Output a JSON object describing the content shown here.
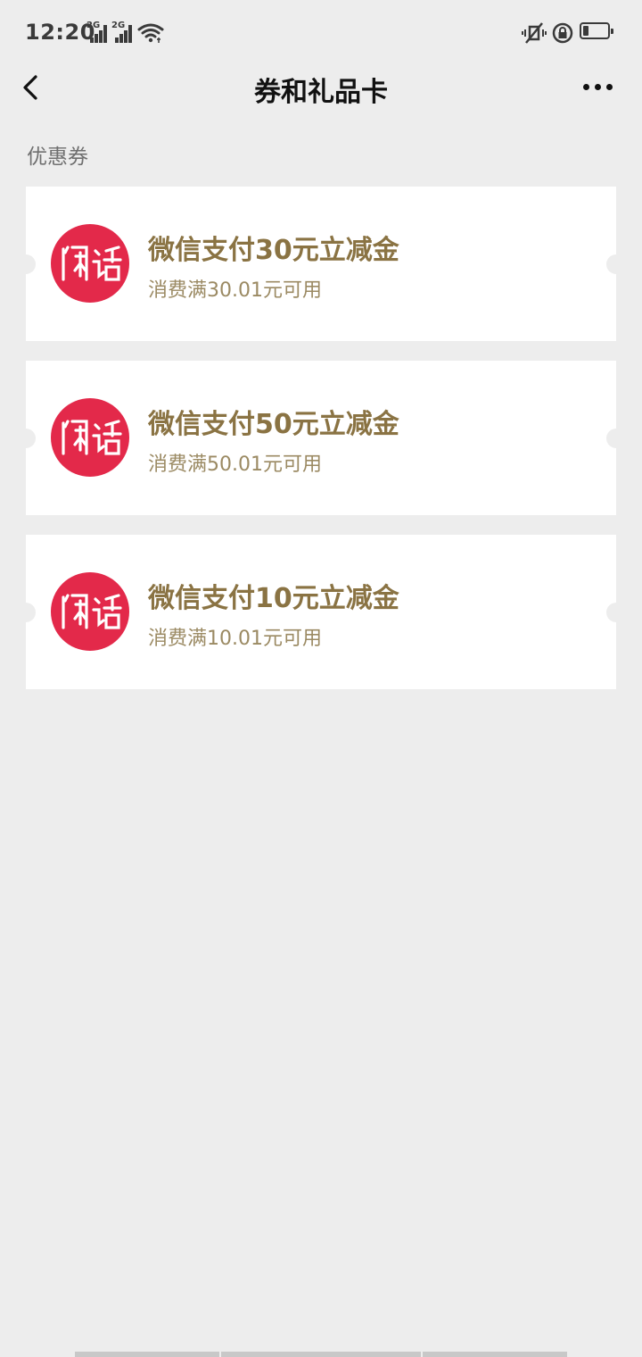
{
  "status_bar": {
    "time": "12:20",
    "signal_1_label": "2G",
    "signal_2_label": "2G",
    "battery_level_fraction": 0.25
  },
  "nav": {
    "title": "券和礼品卡"
  },
  "section": {
    "label": "优惠券"
  },
  "coupons": [
    {
      "title": "微信支付30元立减金",
      "subtitle": "消费满30.01元可用",
      "logo_text": "闲话"
    },
    {
      "title": "微信支付50元立减金",
      "subtitle": "消费满50.01元可用",
      "logo_text": "闲话"
    },
    {
      "title": "微信支付10元立减金",
      "subtitle": "消费满10.01元可用",
      "logo_text": "闲话"
    }
  ],
  "colors": {
    "background": "#ededed",
    "card": "#ffffff",
    "coupon_title": "#8a7343",
    "coupon_subtitle": "#9b8a63",
    "logo_red": "#e3294a"
  }
}
